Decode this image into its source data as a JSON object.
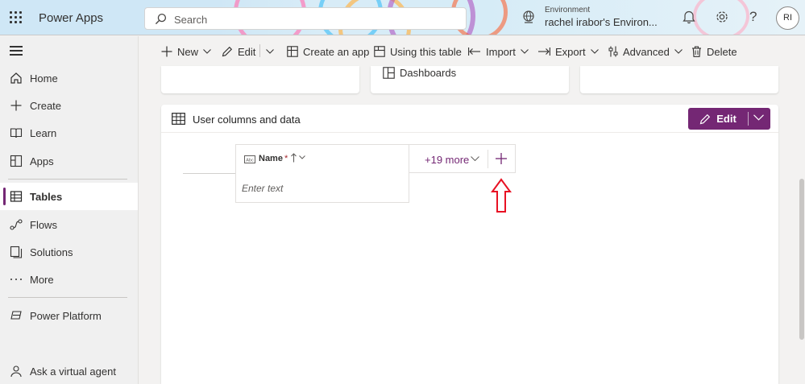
{
  "header": {
    "app_title": "Power Apps",
    "search_placeholder": "Search",
    "environment_label": "Environment",
    "environment_name": "rachel irabor's Environ...",
    "avatar_initials": "RI",
    "help_glyph": "?",
    "accent_color": "#742774"
  },
  "sidebar": {
    "items": [
      {
        "label": "Home",
        "icon": "home-icon"
      },
      {
        "label": "Create",
        "icon": "plus-icon"
      },
      {
        "label": "Learn",
        "icon": "book-icon"
      },
      {
        "label": "Apps",
        "icon": "apps-icon"
      },
      {
        "label": "Tables",
        "icon": "table-icon",
        "active": true
      },
      {
        "label": "Flows",
        "icon": "flow-icon"
      },
      {
        "label": "Solutions",
        "icon": "solutions-icon"
      },
      {
        "label": "More",
        "icon": "more-icon"
      },
      {
        "label": "Power Platform",
        "icon": "power-platform-icon"
      },
      {
        "label": "Ask a virtual agent",
        "icon": "virtual-agent-icon"
      }
    ]
  },
  "commandbar": {
    "new": "New",
    "edit": "Edit",
    "create_app": "Create an app",
    "using_table": "Using this table",
    "import": "Import",
    "export": "Export",
    "advanced": "Advanced",
    "delete": "Delete"
  },
  "cards": {
    "dashboards": "Dashboards"
  },
  "panel": {
    "title": "User columns and data",
    "edit_label": "Edit",
    "column_name": "Name",
    "required_mark": "*",
    "cell_placeholder": "Enter text",
    "more_columns": "+19 more"
  }
}
